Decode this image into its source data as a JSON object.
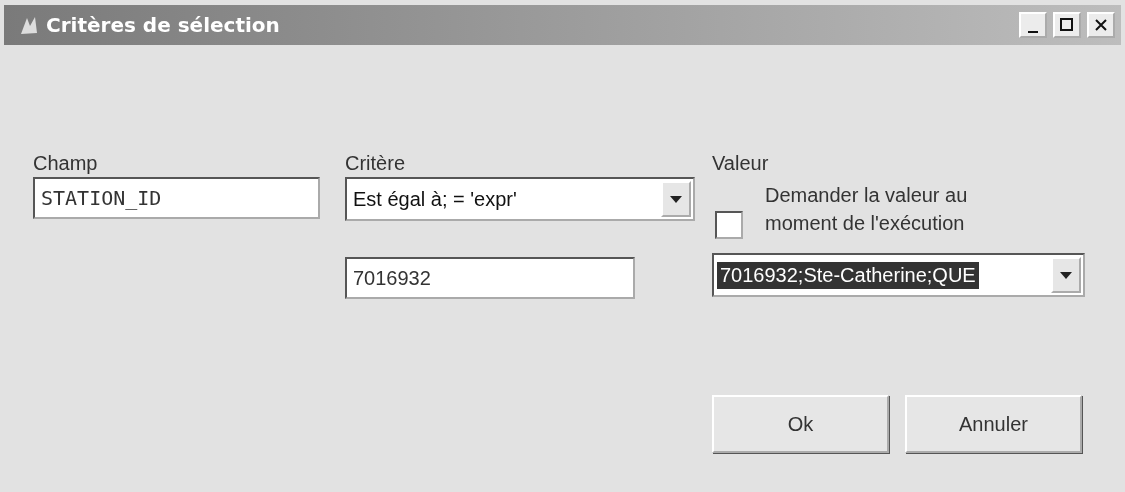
{
  "window": {
    "title": "Critères de sélection",
    "controls": [
      {
        "kind": "minimize"
      },
      {
        "kind": "maximize"
      },
      {
        "kind": "close"
      }
    ]
  },
  "champ": {
    "label": "Champ",
    "value": "STATION_ID"
  },
  "critere": {
    "label": "Critère",
    "value": "Est égal à; = 'expr'",
    "expression": "7016932"
  },
  "valeur": {
    "label": "Valeur",
    "ask_at_runtime": {
      "label": "Demander la valeur au moment de l'exécution",
      "checked": false
    },
    "value": "7016932;Ste-Catherine;QUE",
    "highlighted": true
  },
  "buttons": [
    "Ok",
    "Annuler"
  ]
}
